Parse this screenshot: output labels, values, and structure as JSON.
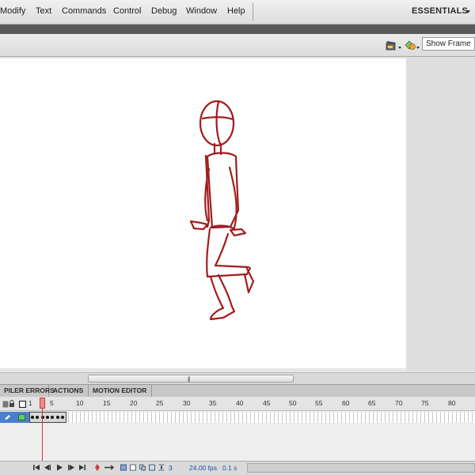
{
  "menubar": {
    "items": [
      "Modify",
      "Text",
      "Commands",
      "Control",
      "Debug",
      "Window",
      "Help"
    ],
    "workspace": "ESSENTIALS"
  },
  "edit_bar": {
    "zoom_value": "Show Frame"
  },
  "panel_tabs": [
    "PILER ERRORS",
    "ACTIONS",
    "MOTION EDITOR"
  ],
  "timeline": {
    "header_frame_marker": "1",
    "ruler": [
      "5",
      "10",
      "15",
      "20",
      "25",
      "30",
      "35",
      "40",
      "45",
      "50",
      "55",
      "60",
      "65",
      "70",
      "75",
      "80"
    ],
    "current_frame": "3",
    "fps": "24.00 fps",
    "elapsed": "0.1 s",
    "keyframe_count": 7
  },
  "colors": {
    "sketch": "#a11d1d",
    "playhead": "#d13434",
    "layer_selected": "#4a7fce"
  }
}
